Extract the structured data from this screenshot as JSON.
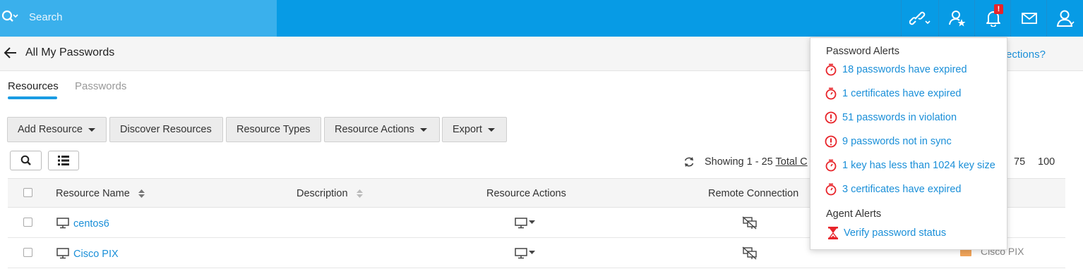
{
  "search": {
    "placeholder": "Search"
  },
  "header": {
    "title": "All My Passwords",
    "help_link": "e connections?"
  },
  "tabs": [
    {
      "label": "Resources",
      "active": true
    },
    {
      "label": "Passwords",
      "active": false
    }
  ],
  "toolbar": {
    "add_resource": "Add Resource",
    "discover_resources": "Discover Resources",
    "resource_types": "Resource Types",
    "resource_actions": "Resource Actions",
    "export": "Export"
  },
  "pagination": {
    "showing": "Showing 1 - 25",
    "total_label": "Total C",
    "sizes": [
      "75",
      "100"
    ]
  },
  "table": {
    "columns": [
      "Resource Name",
      "Description",
      "Resource Actions",
      "Remote Connection"
    ],
    "rows": [
      {
        "name": "centos6",
        "os": ""
      },
      {
        "name": "Cisco PIX",
        "os": "Cisco PIX"
      }
    ]
  },
  "notifications": {
    "badge": "!",
    "password_alerts_title": "Password Alerts",
    "password_alerts": [
      {
        "icon": "timer-icon",
        "text": "18 passwords have expired"
      },
      {
        "icon": "timer-icon",
        "text": "1 certificates have expired"
      },
      {
        "icon": "exclamation-circle-icon",
        "text": "51 passwords in violation"
      },
      {
        "icon": "exclamation-circle-icon",
        "text": "9 passwords not in sync"
      },
      {
        "icon": "timer-icon",
        "text": "1 key has less than 1024 key size"
      },
      {
        "icon": "timer-icon",
        "text": "3 certificates have expired"
      }
    ],
    "agent_alerts_title": "Agent Alerts",
    "agent_alerts": [
      {
        "icon": "hourglass-icon",
        "text": "Verify password status"
      }
    ]
  },
  "colors": {
    "topbar": "#079be5",
    "search_bg": "#3ab0ec",
    "link": "#1a8fd8",
    "alert_red": "#e8242a",
    "accent_tab": "#1a9be3"
  }
}
